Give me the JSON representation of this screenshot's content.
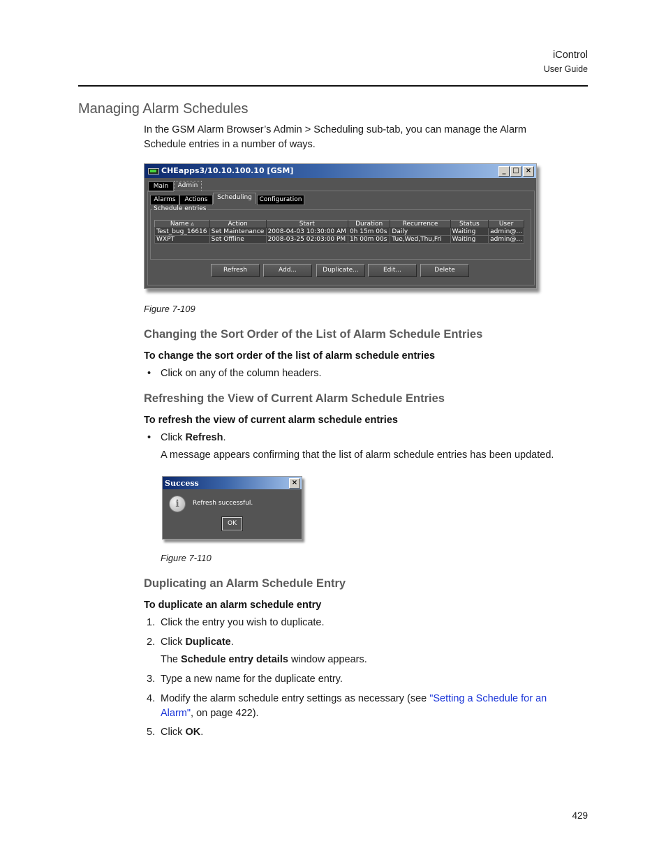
{
  "header": {
    "product": "iControl",
    "doc": "User Guide"
  },
  "page_number": "429",
  "section_title": "Managing Alarm Schedules",
  "intro": "In the GSM Alarm Browser’s Admin > Scheduling sub-tab, you can manage the Alarm Schedule entries in a number of ways.",
  "intro_lines": [
    "In the GSM Alarm Browser’s Admin > Scheduling sub-tab, you can manage the Alarm",
    "Schedule entries in a number of ways."
  ],
  "figure1": {
    "caption": "Figure 7-109",
    "window": {
      "title": "CHEapps3/10.10.100.10 [GSM]",
      "controls": {
        "minimize": "_",
        "maximize": "□",
        "close": "×"
      },
      "main_tabs": [
        {
          "label": "Main",
          "active": false
        },
        {
          "label": "Admin",
          "active": true
        }
      ],
      "sub_tabs": [
        {
          "label": "Alarms",
          "active": false
        },
        {
          "label": "Actions",
          "active": false
        },
        {
          "label": "Scheduling",
          "active": true
        },
        {
          "label": "Configuration",
          "active": false
        }
      ],
      "group_label": "Schedule entries",
      "columns": [
        "Name ▵",
        "Action",
        "Start",
        "Duration",
        "Recurrence",
        "Status",
        "User"
      ],
      "rows": [
        [
          "Test_bug_16616",
          "Set Maintenance",
          "2008-04-03 10:30:00 AM",
          "0h 15m 00s",
          "Daily",
          "Waiting",
          "admin@..."
        ],
        [
          "WXPT",
          "Set Offline",
          "2008-03-25 02:03:00 PM",
          "1h 00m 00s",
          "Tue,Wed,Thu,Fri",
          "Waiting",
          "admin@..."
        ]
      ],
      "buttons": [
        "Refresh",
        "Add...",
        "Duplicate...",
        "Edit...",
        "Delete"
      ]
    }
  },
  "sort": {
    "heading": "Changing the Sort Order of the List of Alarm Schedule Entries",
    "procedure": "To change the sort order of the list of alarm schedule entries",
    "bullet": "Click on any of the column headers."
  },
  "refresh": {
    "heading": "Refreshing the View of Current Alarm Schedule Entries",
    "procedure": "To refresh the view of current alarm schedule entries",
    "bullet_prefix": "Click ",
    "bullet_bold": "Refresh",
    "bullet_suffix": ".",
    "note": "A message appears confirming that the list of alarm schedule entries has been updated."
  },
  "figure2": {
    "caption": "Figure 7-110",
    "dialog": {
      "title": "Success",
      "close": "×",
      "icon": "i",
      "message": "Refresh successful.",
      "ok": "OK"
    }
  },
  "duplicate": {
    "heading": "Duplicating an Alarm Schedule Entry",
    "procedure": "To duplicate an alarm schedule entry",
    "steps": [
      {
        "num": "1.",
        "text": "Click the entry you wish to duplicate."
      },
      {
        "num": "2.",
        "pre": "Click ",
        "bold": "Duplicate",
        "post": "."
      },
      {
        "num": "3.",
        "text": "Type a new name for the duplicate entry."
      },
      {
        "num": "4.",
        "pre": "Modify the alarm schedule entry settings as necessary (see ",
        "link1": "\"Setting a Schedule for an",
        "link2": "Alarm\"",
        "post": ", on page 422)."
      },
      {
        "num": "5.",
        "pre": "Click ",
        "bold": "OK",
        "post": "."
      }
    ],
    "step2_note": {
      "pre": "The ",
      "bold": "Schedule entry details",
      "post": " window appears."
    }
  }
}
